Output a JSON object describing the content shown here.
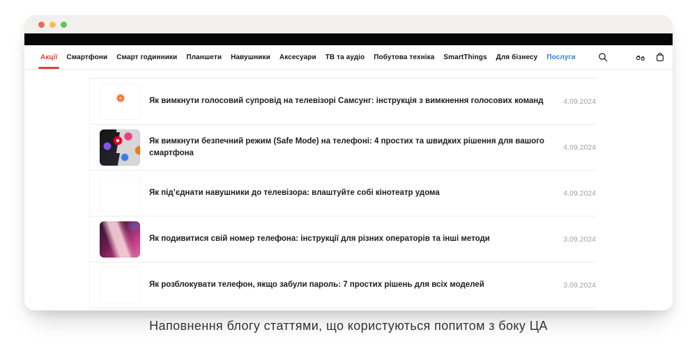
{
  "caption": "Наповнення блогу статтями, що користуються попитом з боку ЦА",
  "colors": {
    "accent_red": "#dd4433",
    "link_blue": "#2e7fe8",
    "date_gray": "#a1a19f"
  },
  "window": {
    "titlebar": {
      "buttons": [
        "close",
        "minimize",
        "maximize"
      ]
    },
    "nav": {
      "items": [
        {
          "label": "Акції",
          "slug": "akcii",
          "state": "active"
        },
        {
          "label": "Смартфони",
          "slug": "smartfony"
        },
        {
          "label": "Смарт годинники",
          "slug": "smart-godynnyky"
        },
        {
          "label": "Планшети",
          "slug": "planshety"
        },
        {
          "label": "Навушники",
          "slug": "navushnyky"
        },
        {
          "label": "Аксесуари",
          "slug": "aksesuary"
        },
        {
          "label": "ТВ та аудіо",
          "slug": "tv-ta-audio"
        },
        {
          "label": "Побутова техніка",
          "slug": "pobutova-tekhnika"
        },
        {
          "label": "SmartThings",
          "slug": "smartthings"
        },
        {
          "label": "Для бізнесу",
          "slug": "dlia-biznesu"
        },
        {
          "label": "Послуги",
          "slug": "posluhy",
          "state": "link"
        }
      ],
      "icons": [
        "search-icon",
        "compare-icon",
        "cart-icon"
      ]
    },
    "articles": [
      {
        "title": "Як вимкнути голосовий супровід на телевізорі Самсунг: інструкція з вимкнення голосових команд",
        "date": "4.09.2024",
        "thumb": "tv-space"
      },
      {
        "title": "Як вимкнути безпечний режим (Safe Mode) на телефоні: 4 простих та швидких рішення для вашого смартфона",
        "date": "4.09.2024",
        "thumb": "apps"
      },
      {
        "title": "Як під’єднати навушники до телевізора: влаштуйте собі кінотеатр удома",
        "date": "4.09.2024",
        "thumb": "tv-menu"
      },
      {
        "title": "Як подивитися свій номер телефона: інструкції для різних операторів та інші методи",
        "date": "3.09.2024",
        "thumb": "phone-pink"
      },
      {
        "title": "Як розблокувати телефон, якщо забули пароль: 7 простих рішень для всіх моделей",
        "date": "3.09.2024",
        "thumb": "tablet-lock"
      }
    ]
  }
}
